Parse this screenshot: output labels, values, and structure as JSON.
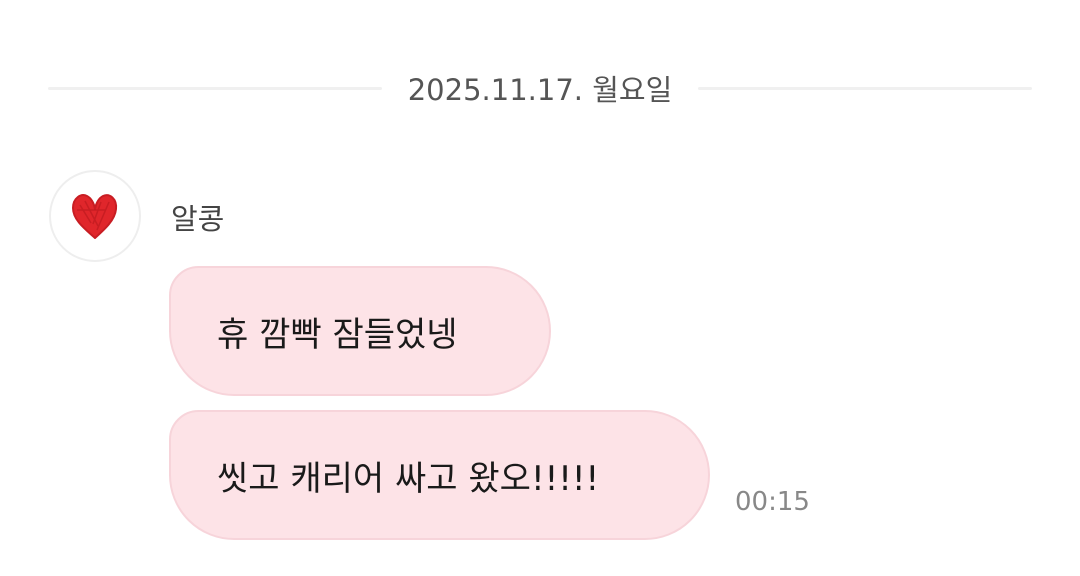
{
  "date_divider": {
    "label": "2025.11.17. 월요일"
  },
  "conversation": {
    "sender": {
      "name": "알콩",
      "avatar_icon": "red-heart-icon",
      "avatar_color": "#e0262b"
    },
    "messages": [
      {
        "text": "휴 깜빡 잠들었넹",
        "time": ""
      },
      {
        "text": "씻고 캐리어 싸고 왔오!!!!!",
        "time": "00:15"
      }
    ],
    "bubble_color": "#fde3e7"
  }
}
